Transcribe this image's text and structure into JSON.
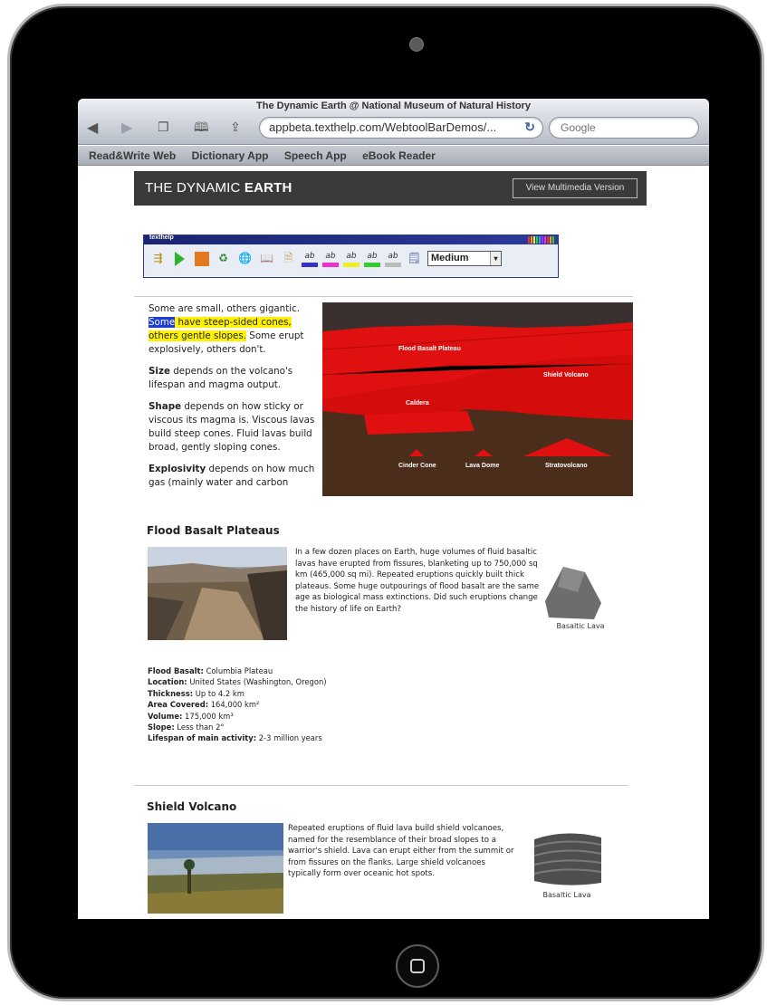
{
  "browser": {
    "title": "The Dynamic Earth @ National Museum of Natural History",
    "url": "appbeta.texthelp.com/WebtoolBarDemos/...",
    "search_placeholder": "Google",
    "bookmarks": [
      "Read&Write Web",
      "Dictionary App",
      "Speech App",
      "eBook Reader"
    ]
  },
  "page": {
    "header_title_light": "THE DYNAMIC ",
    "header_title_bold": "EARTH",
    "view_multimedia_label": "View Multimedia Version"
  },
  "toolbar": {
    "brand": "texthelp",
    "speed_value": "Medium"
  },
  "intro": {
    "p1_a": "Some are small, others gigantic.",
    "p1_highlight_blue": "Some",
    "p1_highlight_yellow": " have steep-sided cones, others gentle slopes.",
    "p1_b": " Some erupt explosively, others don't.",
    "p2_bold": "Size",
    "p2": " depends on the volcano's lifespan and magma output.",
    "p3_bold": "Shape",
    "p3": " depends on how sticky or viscous its magma is. Viscous lavas build steep cones. Fluid lavas build broad, gently sloping cones.",
    "p4_bold": "Explosivity",
    "p4": " depends on how much gas (mainly water and carbon"
  },
  "diagram": {
    "labels": {
      "flood_basalt": "Flood Basalt Plateau",
      "shield": "Shield Volcano",
      "caldera": "Caldera",
      "cinder": "Cinder Cone",
      "lava_dome": "Lava Dome",
      "strato": "Stratovolcano"
    }
  },
  "flood": {
    "title": "Flood Basalt Plateaus",
    "text": "In a few dozen places on Earth, huge volumes of fluid basaltic lavas have erupted from fissures, blanketing up to 750,000 sq km (465,000 sq mi). Repeated eruptions quickly built thick plateaus. Some huge outpourings of flood basalt are the same age as biological mass extinctions. Did such eruptions change the history of life on Earth?",
    "rock_caption": "Basaltic Lava",
    "facts": {
      "basalt_label": "Flood Basalt:",
      "basalt_value": " Columbia Plateau",
      "location_label": "Location:",
      "location_value": " United States (Washington, Oregon)",
      "thickness_label": "Thickness:",
      "thickness_value": " Up to 4.2 km",
      "area_label": "Area Covered:",
      "area_value": " 164,000 km²",
      "volume_label": "Volume:",
      "volume_value": " 175,000 km³",
      "slope_label": "Slope:",
      "slope_value": " Less than 2°",
      "lifespan_label": "Lifespan of main activity:",
      "lifespan_value": " 2-3 million years"
    }
  },
  "shield": {
    "title": "Shield Volcano",
    "text": "Repeated eruptions of fluid lava build shield volcanoes, named for the resemblance of their broad slopes to a warrior's shield. Lava can erupt either from the summit or from fissures on the flanks. Large shield volcanoes typically form over oceanic hot spots.",
    "rock_caption": "Basaltic Lava"
  },
  "colors": {
    "lava_red": "#e01010",
    "earth_brown": "#4a2d1a",
    "header_bg": "#3a3a3a",
    "highlight_yellow": "#fff200",
    "highlight_blue": "#1e3cd8"
  }
}
